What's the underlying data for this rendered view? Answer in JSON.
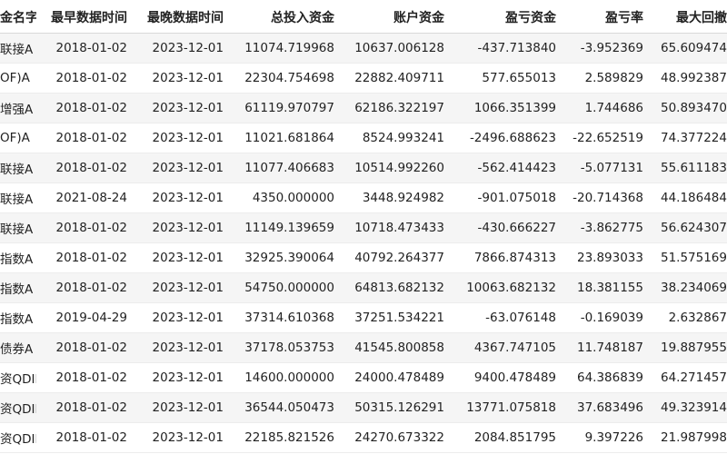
{
  "table": {
    "columns": [
      "金名字",
      "最早数据时间",
      "最晚数据时间",
      "总投入资金",
      "账户资金",
      "盈亏资金",
      "盈亏率",
      "最大回撤"
    ],
    "rows": [
      [
        "联接A",
        "2018-01-02",
        "2023-12-01",
        "11074.719968",
        "10637.006128",
        "-437.713840",
        "-3.952369",
        "65.609474"
      ],
      [
        "OF)A",
        "2018-01-02",
        "2023-12-01",
        "22304.754698",
        "22882.409711",
        "577.655013",
        "2.589829",
        "48.992387"
      ],
      [
        "增强A",
        "2018-01-02",
        "2023-12-01",
        "61119.970797",
        "62186.322197",
        "1066.351399",
        "1.744686",
        "50.893470"
      ],
      [
        "OF)A",
        "2018-01-02",
        "2023-12-01",
        "11021.681864",
        "8524.993241",
        "-2496.688623",
        "-22.652519",
        "74.377224"
      ],
      [
        "联接A",
        "2018-01-02",
        "2023-12-01",
        "11077.406683",
        "10514.992260",
        "-562.414423",
        "-5.077131",
        "55.611183"
      ],
      [
        "联接A",
        "2021-08-24",
        "2023-12-01",
        "4350.000000",
        "3448.924982",
        "-901.075018",
        "-20.714368",
        "44.186484"
      ],
      [
        "联接A",
        "2018-01-02",
        "2023-12-01",
        "11149.139659",
        "10718.473433",
        "-430.666227",
        "-3.862775",
        "56.624307"
      ],
      [
        "指数A",
        "2018-01-02",
        "2023-12-01",
        "32925.390064",
        "40792.264377",
        "7866.874313",
        "23.893033",
        "51.575169"
      ],
      [
        "指数A",
        "2018-01-02",
        "2023-12-01",
        "54750.000000",
        "64813.682132",
        "10063.682132",
        "18.381155",
        "38.234069"
      ],
      [
        "指数A",
        "2019-04-29",
        "2023-12-01",
        "37314.610368",
        "37251.534221",
        "-63.076148",
        "-0.169039",
        "2.632867"
      ],
      [
        "债券A",
        "2018-01-02",
        "2023-12-01",
        "37178.053753",
        "41545.800858",
        "4367.747105",
        "11.748187",
        "19.887955"
      ],
      [
        "资QDII",
        "2018-01-02",
        "2023-12-01",
        "14600.000000",
        "24000.478489",
        "9400.478489",
        "64.386839",
        "64.271457"
      ],
      [
        "资QDII",
        "2018-01-02",
        "2023-12-01",
        "36544.050473",
        "50315.126291",
        "13771.075818",
        "37.683496",
        "49.323914"
      ],
      [
        "资QDII",
        "2018-01-02",
        "2023-12-01",
        "22185.821526",
        "24270.673322",
        "2084.851795",
        "9.397226",
        "21.987998"
      ]
    ]
  }
}
